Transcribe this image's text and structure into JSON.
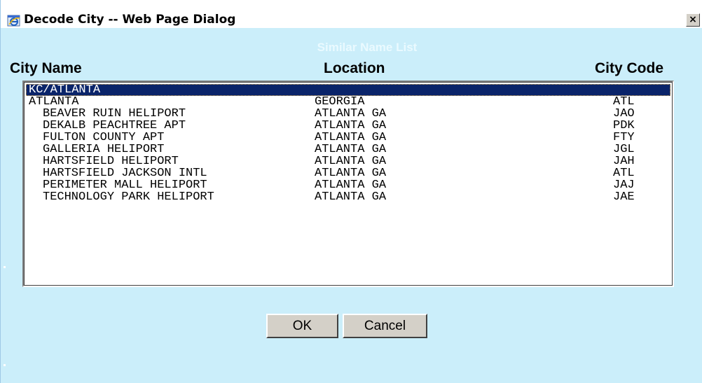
{
  "window": {
    "title": "Decode City -- Web Page Dialog",
    "close_label": "×"
  },
  "dialog": {
    "subtitle": "Similar Name List",
    "columns": {
      "city_name": "City Name",
      "location": "Location",
      "city_code": "City Code"
    },
    "rows": [
      {
        "name": "KC/ATLANTA",
        "location": "",
        "code": "",
        "selected": true,
        "indent": false
      },
      {
        "name": "ATLANTA",
        "location": "GEORGIA",
        "code": "ATL",
        "selected": false,
        "indent": false
      },
      {
        "name": "BEAVER RUIN HELIPORT",
        "location": "ATLANTA GA",
        "code": "JAO",
        "selected": false,
        "indent": true
      },
      {
        "name": "DEKALB PEACHTREE APT",
        "location": "ATLANTA GA",
        "code": "PDK",
        "selected": false,
        "indent": true
      },
      {
        "name": "FULTON COUNTY APT",
        "location": "ATLANTA GA",
        "code": "FTY",
        "selected": false,
        "indent": true
      },
      {
        "name": "GALLERIA HELIPORT",
        "location": "ATLANTA GA",
        "code": "JGL",
        "selected": false,
        "indent": true
      },
      {
        "name": "HARTSFIELD HELIPORT",
        "location": "ATLANTA GA",
        "code": "JAH",
        "selected": false,
        "indent": true
      },
      {
        "name": "HARTSFIELD JACKSON INTL",
        "location": "ATLANTA GA",
        "code": "ATL",
        "selected": false,
        "indent": true
      },
      {
        "name": "PERIMETER MALL HELIPORT",
        "location": "ATLANTA GA",
        "code": "JAJ",
        "selected": false,
        "indent": true
      },
      {
        "name": "TECHNOLOGY PARK HELIPORT",
        "location": "ATLANTA GA",
        "code": "JAE",
        "selected": false,
        "indent": true
      }
    ],
    "ok_label": "OK",
    "cancel_label": "Cancel"
  },
  "icons": {
    "title_icon": "ie-dialog-icon",
    "close_icon": "close-icon"
  },
  "colors": {
    "dialog_background": "#cbeefa",
    "selection_background": "#0a246a",
    "button_face": "#d4d0c8"
  }
}
